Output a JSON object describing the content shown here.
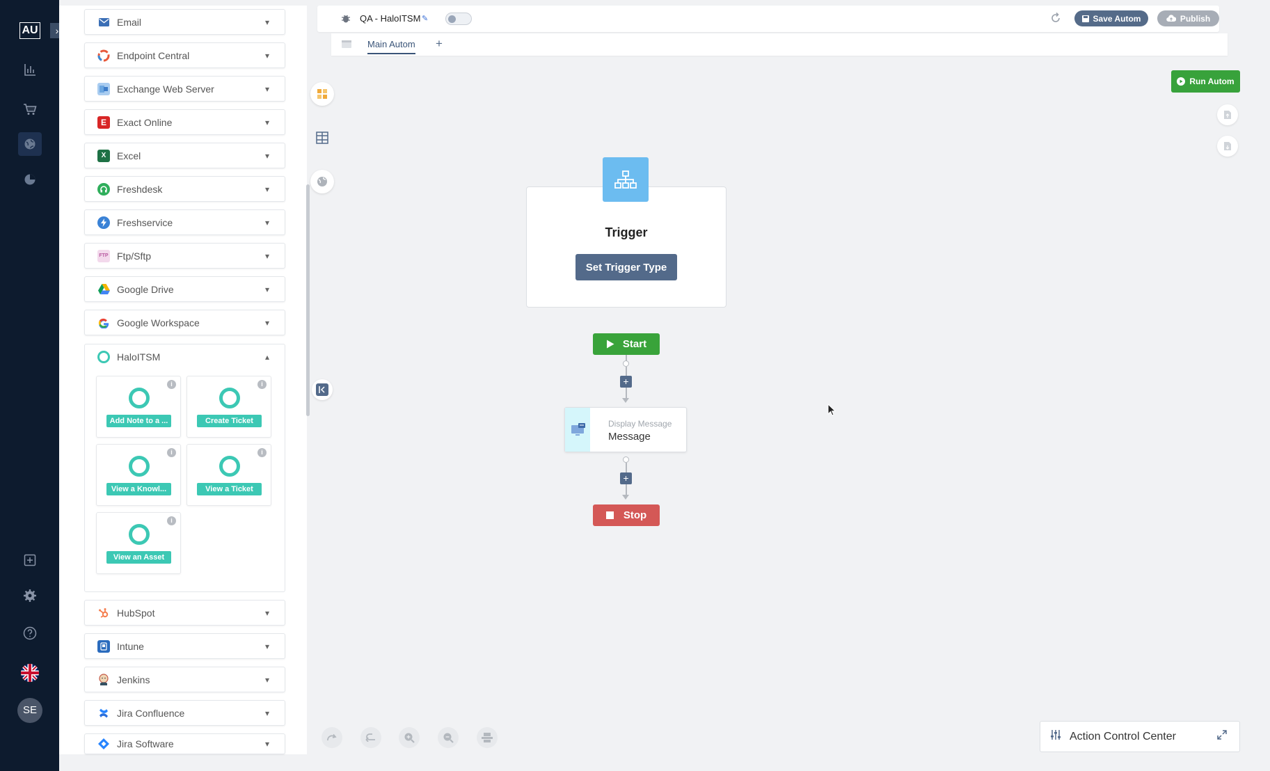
{
  "nav": {
    "logo": "AU",
    "avatar": "SE"
  },
  "sidebar": {
    "items": [
      {
        "label": "Email",
        "icon": "envelope-icon",
        "color": "#3b6fb6"
      },
      {
        "label": "Endpoint Central",
        "icon": "endpoint-central-icon",
        "color": "#e8593b"
      },
      {
        "label": "Exchange Web Server",
        "icon": "exchange-icon",
        "color": "#6ba6e0"
      },
      {
        "label": "Exact Online",
        "icon": "exact-online-icon",
        "color": "#d82626"
      },
      {
        "label": "Excel",
        "icon": "excel-icon",
        "color": "#1e7145"
      },
      {
        "label": "Freshdesk",
        "icon": "freshdesk-icon",
        "color": "#2fae5b"
      },
      {
        "label": "Freshservice",
        "icon": "freshservice-icon",
        "color": "#3a82d6"
      },
      {
        "label": "Ftp/Sftp",
        "icon": "ftp-icon",
        "color": "#c77bb5"
      },
      {
        "label": "Google Drive",
        "icon": "google-drive-icon",
        "color": "#f4b400"
      },
      {
        "label": "Google Workspace",
        "icon": "google-icon",
        "color": "#4285f4"
      }
    ],
    "halo": {
      "label": "HaloITSM",
      "actions": [
        {
          "label": "Add Note to a ..."
        },
        {
          "label": "Create Ticket"
        },
        {
          "label": "View a Knowl..."
        },
        {
          "label": "View a Ticket"
        },
        {
          "label": "View an Asset"
        }
      ]
    },
    "items_after": [
      {
        "label": "HubSpot",
        "icon": "hubspot-icon",
        "color": "#f57e4f"
      },
      {
        "label": "Intune",
        "icon": "intune-icon",
        "color": "#2a6bbd"
      },
      {
        "label": "Jenkins",
        "icon": "jenkins-icon",
        "color": "#c45b48"
      },
      {
        "label": "Jira Confluence",
        "icon": "confluence-icon",
        "color": "#2a6fdc"
      },
      {
        "label": "Jira Software",
        "icon": "jira-icon",
        "color": "#2684ff"
      }
    ]
  },
  "topbar": {
    "title": "QA - HaloITSM",
    "save_label": "Save Autom",
    "publish_label": "Publish",
    "run_label": "Run Autom"
  },
  "tabs": {
    "active": "Main Autom",
    "add": "+"
  },
  "canvas": {
    "trigger_title": "Trigger",
    "trigger_button": "Set Trigger Type",
    "start_label": "Start",
    "stop_label": "Stop",
    "message_sub": "Display Message",
    "message_main": "Message",
    "plus": "+"
  },
  "action_center": {
    "label": "Action Control Center"
  },
  "colors": {
    "nav_bg": "#0d1b2e",
    "accent": "#536a8a",
    "halo": "#3cc8b4",
    "start": "#39a33a",
    "stop": "#d45856",
    "run": "#38a23b"
  }
}
